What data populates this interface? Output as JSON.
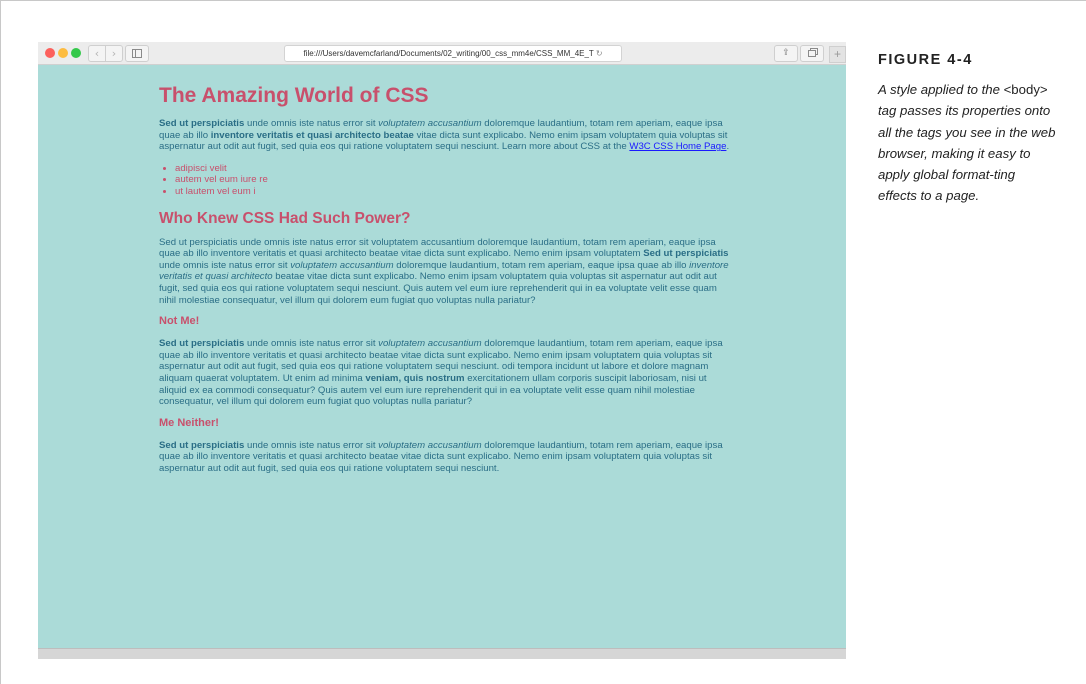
{
  "browser": {
    "url": "file:///Users/davemcfarland/Documents/02_writing/00_css_mm4e/CSS_MM_4E_T",
    "reload_glyph": "↻",
    "back_glyph": "‹",
    "forward_glyph": "›",
    "share_glyph": "⇪",
    "new_tab_glyph": "+",
    "colors": {
      "page_bg": "#abdbd8",
      "heading": "#c8506c",
      "text": "#2a6e86",
      "link": "#1a1aff"
    }
  },
  "page": {
    "h1": "The Amazing World of CSS",
    "intro": {
      "b1": "Sed ut perspiciatis",
      "t1": " unde omnis iste natus error sit ",
      "i1": "voluptatem accusantium",
      "t2": " doloremque laudantium, totam rem aperiam, eaque ipsa quae ab illo ",
      "b2": "inventore veritatis et quasi architecto beatae",
      "t3": " vitae dicta sunt explicabo. Nemo enim ipsam voluptatem quia voluptas sit aspernatur aut odit aut fugit, sed quia eos qui ratione voluptatem sequi nesciunt. Learn more about CSS at the ",
      "link": "W3C CSS Home Page",
      "t4": "."
    },
    "list": [
      "adipisci velit",
      "autem vel eum iure re",
      "ut lautem vel eum i"
    ],
    "h2": "Who Knew CSS Had Such Power?",
    "p2": {
      "t1": "Sed ut perspiciatis unde omnis iste natus error sit voluptatem accusantium doloremque laudantium, totam rem aperiam, eaque ipsa quae ab illo inventore veritatis et quasi architecto beatae vitae dicta sunt explicabo. Nemo enim ipsam voluptatem ",
      "b1": "Sed ut perspiciatis",
      "t2": " unde omnis iste natus error sit ",
      "i1": "voluptatem accusantium",
      "t3": " doloremque laudantium, totam rem aperiam, eaque ipsa quae ab illo ",
      "i2": "inventore veritatis et quasi architecto",
      "t4": " beatae vitae dicta sunt explicabo. Nemo enim ipsam voluptatem quia voluptas sit aspernatur aut odit aut fugit, sed quia eos qui ratione voluptatem sequi nesciunt. Quis autem vel eum iure reprehenderit qui in ea voluptate velit esse quam nihil molestiae consequatur, vel illum qui dolorem eum fugiat quo voluptas nulla pariatur?"
    },
    "h3a": "Not Me!",
    "p3": {
      "b1": "Sed ut perspiciatis",
      "t1": " unde omnis iste natus error sit ",
      "i1": "voluptatem accusantium",
      "t2": " doloremque laudantium, totam rem aperiam, eaque ipsa quae ab illo inventore veritatis et quasi architecto beatae vitae dicta sunt explicabo. Nemo enim ipsam voluptatem quia voluptas sit aspernatur aut odit aut fugit, sed quia eos qui ratione voluptatem sequi nesciunt. odi tempora incidunt ut labore et dolore magnam aliquam quaerat voluptatem. Ut enim ad minima ",
      "b2": "veniam, quis nostrum",
      "t3": " exercitationem ullam corporis suscipit laboriosam, nisi ut aliquid ex ea commodi consequatur? Quis autem vel eum iure reprehenderit qui in ea voluptate velit esse quam nihil molestiae consequatur, vel illum qui dolorem eum fugiat quo voluptas nulla pariatur?"
    },
    "h3b": "Me Neither!",
    "p4": {
      "b1": "Sed ut perspiciatis",
      "t1": " unde omnis iste natus error sit ",
      "i1": "voluptatem accusantium",
      "t2": " doloremque laudantium, totam rem aperiam, eaque ipsa quae ab illo inventore veritatis et quasi architecto beatae vitae dicta sunt explicabo. Nemo enim ipsam voluptatem quia voluptas sit aspernatur aut odit aut fugit, sed quia eos qui ratione voluptatem sequi nesciunt."
    }
  },
  "caption": {
    "title": "FIGURE 4-4",
    "t1": "A style applied to the ",
    "code": "<body>",
    "t2": " tag passes its properties onto all the tags you see in the web browser, making it easy to apply global format-ting effects to a page."
  }
}
